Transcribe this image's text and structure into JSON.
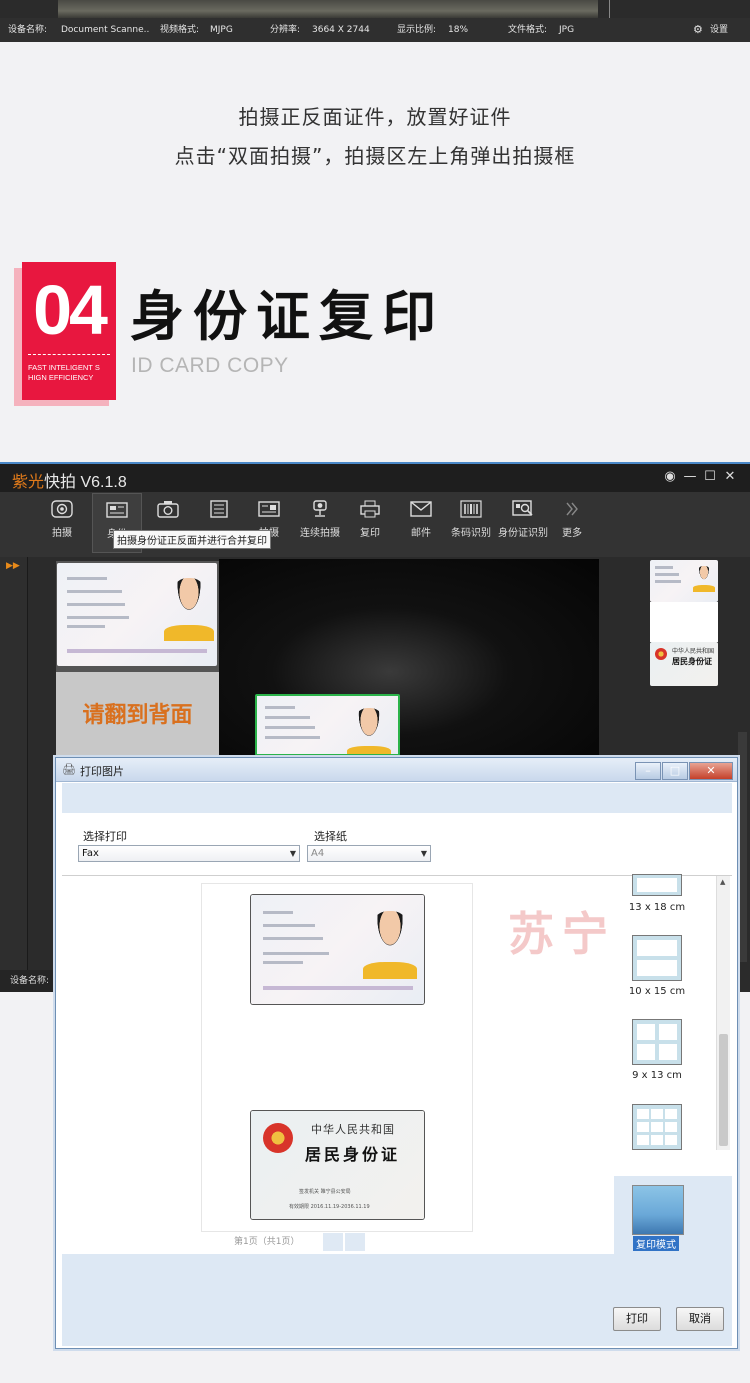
{
  "status_bar": {
    "device_label": "设备名称:",
    "device_value": "Document Scanne..",
    "video_format_label": "视频格式:",
    "video_format_value": "MJPG",
    "resolution_label": "分辨率:",
    "resolution_value": "3664 X 2744",
    "display_ratio_label": "显示比例:",
    "display_ratio_value": "18%",
    "file_format_label": "文件格式:",
    "file_format_value": "JPG",
    "settings_label": "设置"
  },
  "caption": {
    "line1": "拍摄正反面证件，放置好证件",
    "line2": "点击“双面拍摄”，拍摄区左上角弹出拍摄框"
  },
  "section": {
    "number": "04",
    "tagline_1": "FAST INTELIGENT S",
    "tagline_2": "HIGN EFFICIENCY",
    "title": "身份证复印",
    "subtitle": "ID CARD COPY"
  },
  "app": {
    "brand": "紫光",
    "title_rest": "快拍 V6.1.8",
    "tooltip": "拍摄身份证正反面并进行合并复印",
    "flip_prompt": "请翻到背面",
    "status_device_label": "设备名称:",
    "toolbar": [
      {
        "label": "拍摄",
        "icon": "camera-icon"
      },
      {
        "label": "身份",
        "icon": "id-card-icon"
      },
      {
        "label": "",
        "icon": "camera-icon"
      },
      {
        "label": "",
        "icon": "document-icon"
      },
      {
        "label": "拍摄",
        "icon": "id-card-icon"
      },
      {
        "label": "连续拍摄",
        "icon": "burst-camera-icon"
      },
      {
        "label": "复印",
        "icon": "printer-icon"
      },
      {
        "label": "邮件",
        "icon": "mail-icon"
      },
      {
        "label": "条码识别",
        "icon": "barcode-icon"
      },
      {
        "label": "身份证识别",
        "icon": "id-scan-icon"
      },
      {
        "label": "更多",
        "icon": "more-chevron-icon"
      }
    ]
  },
  "id_card": {
    "back_line1": "中华人民共和国",
    "back_line2": "居民身份证",
    "authority_label": "签发机关",
    "authority_value": "睢宁县公安局",
    "validity_label": "有效期限",
    "validity_value": "2016.11.19-2036.11.19"
  },
  "print_dialog": {
    "title": "打印图片",
    "printer_label": "选择打印",
    "printer_value": "Fax",
    "paper_label": "选择纸",
    "paper_value": "A4",
    "page_info": "第1页（共1页）",
    "watermark": "苏宁",
    "sizes": [
      "13 x 18 cm",
      "10 x 15 cm",
      "9 x 13 cm"
    ],
    "copy_mode_label": "复印模式",
    "print_button": "打印",
    "cancel_button": "取消"
  }
}
